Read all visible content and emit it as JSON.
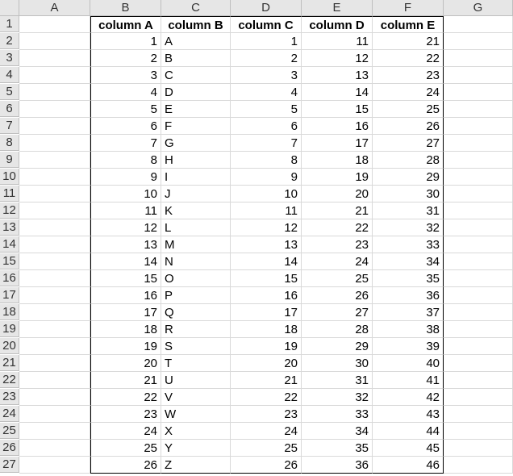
{
  "columns": [
    "A",
    "B",
    "C",
    "D",
    "E",
    "F",
    "G"
  ],
  "rows": [
    1,
    2,
    3,
    4,
    5,
    6,
    7,
    8,
    9,
    10,
    11,
    12,
    13,
    14,
    15,
    16,
    17,
    18,
    19,
    20,
    21,
    22,
    23,
    24,
    25,
    26,
    27
  ],
  "headers": {
    "B": "column A",
    "C": "column B",
    "D": "column C",
    "E": "column D",
    "F": "column E"
  },
  "data": [
    {
      "b": 1,
      "c": "A",
      "d": 1,
      "e": 11,
      "f": 21
    },
    {
      "b": 2,
      "c": "B",
      "d": 2,
      "e": 12,
      "f": 22
    },
    {
      "b": 3,
      "c": "C",
      "d": 3,
      "e": 13,
      "f": 23
    },
    {
      "b": 4,
      "c": "D",
      "d": 4,
      "e": 14,
      "f": 24
    },
    {
      "b": 5,
      "c": "E",
      "d": 5,
      "e": 15,
      "f": 25
    },
    {
      "b": 6,
      "c": "F",
      "d": 6,
      "e": 16,
      "f": 26
    },
    {
      "b": 7,
      "c": "G",
      "d": 7,
      "e": 17,
      "f": 27
    },
    {
      "b": 8,
      "c": "H",
      "d": 8,
      "e": 18,
      "f": 28
    },
    {
      "b": 9,
      "c": "I",
      "d": 9,
      "e": 19,
      "f": 29
    },
    {
      "b": 10,
      "c": "J",
      "d": 10,
      "e": 20,
      "f": 30
    },
    {
      "b": 11,
      "c": "K",
      "d": 11,
      "e": 21,
      "f": 31
    },
    {
      "b": 12,
      "c": "L",
      "d": 12,
      "e": 22,
      "f": 32
    },
    {
      "b": 13,
      "c": "M",
      "d": 13,
      "e": 23,
      "f": 33
    },
    {
      "b": 14,
      "c": "N",
      "d": 14,
      "e": 24,
      "f": 34
    },
    {
      "b": 15,
      "c": "O",
      "d": 15,
      "e": 25,
      "f": 35
    },
    {
      "b": 16,
      "c": "P",
      "d": 16,
      "e": 26,
      "f": 36
    },
    {
      "b": 17,
      "c": "Q",
      "d": 17,
      "e": 27,
      "f": 37
    },
    {
      "b": 18,
      "c": "R",
      "d": 18,
      "e": 28,
      "f": 38
    },
    {
      "b": 19,
      "c": "S",
      "d": 19,
      "e": 29,
      "f": 39
    },
    {
      "b": 20,
      "c": "T",
      "d": 20,
      "e": 30,
      "f": 40
    },
    {
      "b": 21,
      "c": "U",
      "d": 21,
      "e": 31,
      "f": 41
    },
    {
      "b": 22,
      "c": "V",
      "d": 22,
      "e": 32,
      "f": 42
    },
    {
      "b": 23,
      "c": "W",
      "d": 23,
      "e": 33,
      "f": 43
    },
    {
      "b": 24,
      "c": "X",
      "d": 24,
      "e": 34,
      "f": 44
    },
    {
      "b": 25,
      "c": "Y",
      "d": 25,
      "e": 35,
      "f": 45
    },
    {
      "b": 26,
      "c": "Z",
      "d": 26,
      "e": 36,
      "f": 46
    }
  ],
  "chart_data": {
    "type": "table",
    "title": "",
    "columns": [
      "column A",
      "column B",
      "column C",
      "column D",
      "column E"
    ],
    "rows": [
      [
        1,
        "A",
        1,
        11,
        21
      ],
      [
        2,
        "B",
        2,
        12,
        22
      ],
      [
        3,
        "C",
        3,
        13,
        23
      ],
      [
        4,
        "D",
        4,
        14,
        24
      ],
      [
        5,
        "E",
        5,
        15,
        25
      ],
      [
        6,
        "F",
        6,
        16,
        26
      ],
      [
        7,
        "G",
        7,
        17,
        27
      ],
      [
        8,
        "H",
        8,
        18,
        28
      ],
      [
        9,
        "I",
        9,
        19,
        29
      ],
      [
        10,
        "J",
        10,
        20,
        30
      ],
      [
        11,
        "K",
        11,
        21,
        31
      ],
      [
        12,
        "L",
        12,
        22,
        32
      ],
      [
        13,
        "M",
        13,
        23,
        33
      ],
      [
        14,
        "N",
        14,
        24,
        34
      ],
      [
        15,
        "O",
        15,
        25,
        35
      ],
      [
        16,
        "P",
        16,
        26,
        36
      ],
      [
        17,
        "Q",
        17,
        27,
        37
      ],
      [
        18,
        "R",
        18,
        28,
        38
      ],
      [
        19,
        "S",
        19,
        29,
        39
      ],
      [
        20,
        "T",
        20,
        30,
        40
      ],
      [
        21,
        "U",
        21,
        31,
        41
      ],
      [
        22,
        "V",
        22,
        32,
        42
      ],
      [
        23,
        "W",
        23,
        33,
        43
      ],
      [
        24,
        "X",
        24,
        34,
        44
      ],
      [
        25,
        "Y",
        25,
        35,
        45
      ],
      [
        26,
        "Z",
        26,
        36,
        46
      ]
    ]
  }
}
